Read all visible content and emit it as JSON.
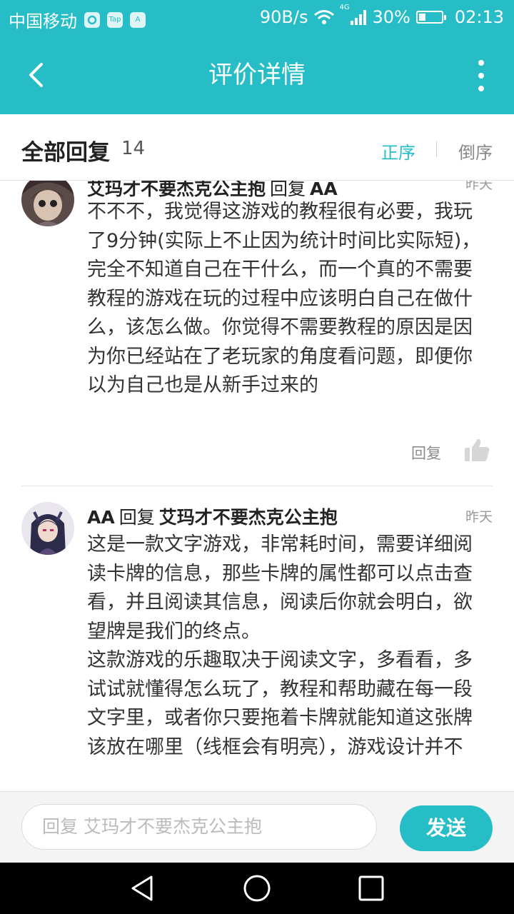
{
  "status_bar": {
    "carrier": "中国移动",
    "app_icons": [
      "Tap",
      "A"
    ],
    "net_speed": "90B/s",
    "network": "4G",
    "battery": "30%",
    "battery_level": 0.3,
    "time": "02:13"
  },
  "header": {
    "title": "评价详情"
  },
  "sort_bar": {
    "label": "全部回复",
    "count": "14",
    "ascending": "正序",
    "descending": "倒序",
    "active_color": "#26bdc6"
  },
  "replies": [
    {
      "author": "艾玛才不要杰克公主抱",
      "verb": "回复",
      "target": "AA",
      "time": "昨天",
      "paragraphs": [
        "不不不，我觉得这游戏的教程很有必要，我玩了9分钟(实际上不止因为统计时间比实际短)，完全不知道自己在干什么，而一个真的不需要教程的游戏在玩的过程中应该明白自己在做什么，该怎么做。你觉得不需要教程的原因是因为你已经站在了老玩家的角度看问题，即便你以为自己也是从新手过来的"
      ],
      "reply_label": "回复"
    },
    {
      "author": "AA",
      "verb": "回复",
      "target": "艾玛才不要杰克公主抱",
      "time": "昨天",
      "paragraphs": [
        "这是一款文字游戏，非常耗时间，需要详细阅读卡牌的信息，那些卡牌的属性都可以点击查看，并且阅读其信息，阅读后你就会明白，欲望牌是我们的终点。",
        "这款游戏的乐趣取决于阅读文字，多看看，多试试就懂得怎么玩了，教程和帮助藏在每一段文字里，或者你只要拖着卡牌就能知道这张牌该放在哪里（线框会有明亮），游戏设计并不"
      ]
    }
  ],
  "input_bar": {
    "placeholder": "回复 艾玛才不要杰克公主抱",
    "send_label": "发送"
  },
  "nav_bar": {
    "icons": [
      "back-triangle-icon",
      "home-circle-icon",
      "recents-square-icon"
    ]
  }
}
